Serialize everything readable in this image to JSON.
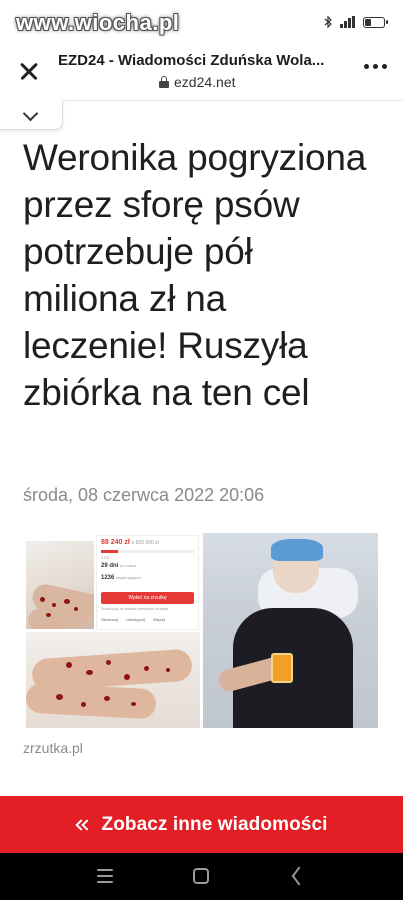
{
  "status_bar": {
    "watermark": "www.wiocha.pl",
    "icons": [
      "bluetooth-icon",
      "signal-icon",
      "battery-icon"
    ]
  },
  "browser": {
    "page_title": "EZD24 - Wiadomości Zduńska Wola...",
    "url": "ezd24.net",
    "icons": [
      "close-icon",
      "lock-icon",
      "more-vert-icon",
      "chevron-down-icon"
    ]
  },
  "article": {
    "headline": "Weronika pogryziona przez sforę psów potrzebuje pół miliona zł na leczenie! Ruszyła zbiórka na ten cel",
    "date": "środa, 08 czerwca 2022 20:06",
    "image_source": "zrzutka.pl",
    "screenshot_card": {
      "amount": "88 240 zł",
      "goal": "z 500 000 zł",
      "percent": "17%",
      "days_value": "29 dni",
      "days_label": "do końca",
      "supporters_value": "1236",
      "supporters_label": "wspierających",
      "support_button": "Wpłać na zrzutkę",
      "promo_text": "Zrzutkuj się na pokazie prezentów ud wpłat",
      "actions": [
        "Obserwuj",
        "Udostępnij",
        "Więcej"
      ],
      "progress_fraction": 0.18
    }
  },
  "banner": {
    "label": "Zobacz inne wiadomości"
  },
  "colors": {
    "banner_red": "#e31e24",
    "headline": "#1f1f1f",
    "muted": "#8a8a8a"
  }
}
